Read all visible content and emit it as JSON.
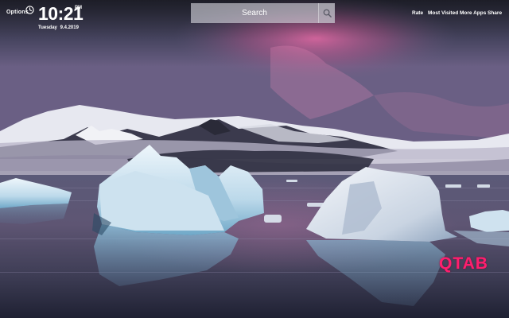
{
  "toolbar": {
    "options_label": "Options",
    "clock_icon": "clock-icon",
    "time": "10:21",
    "ampm": "PM",
    "day": "Tuesday",
    "date": "9.4.2019"
  },
  "search": {
    "placeholder": "Search",
    "icon": "search-icon"
  },
  "nav": {
    "items": [
      {
        "label": "Rate"
      },
      {
        "label": "Most Visited"
      },
      {
        "label": "More Apps"
      },
      {
        "label": "Share"
      }
    ]
  },
  "brand": {
    "logo_text": "QTAB",
    "logo_color": "#ff1e6e"
  },
  "background": {
    "subject": "icebergs-on-lagoon-wallpaper"
  }
}
